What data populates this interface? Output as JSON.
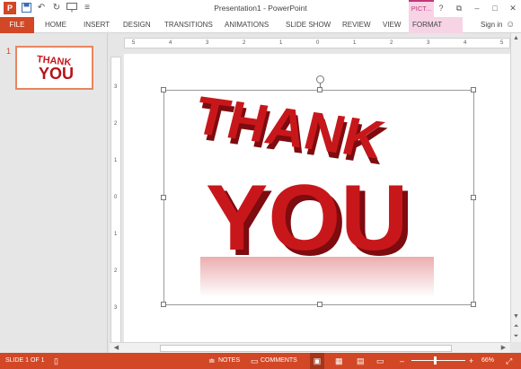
{
  "window": {
    "title": "Presentation1 - PowerPoint",
    "contextual_tab": "PICT...",
    "help": "?",
    "controls": [
      "⧉",
      "–",
      "□",
      "✕"
    ]
  },
  "qat": {
    "logo": "P"
  },
  "ribbon": {
    "file": "FILE",
    "tabs": [
      "HOME",
      "INSERT",
      "DESIGN",
      "TRANSITIONS",
      "ANIMATIONS",
      "SLIDE SHOW",
      "REVIEW",
      "VIEW",
      "FORMAT"
    ],
    "signin": "Sign in"
  },
  "thumbnails": [
    {
      "number": "1"
    }
  ],
  "slide": {
    "line1": "THANK",
    "line2": "YOU"
  },
  "rulers": {
    "horizontal": [
      "5",
      "4",
      "3",
      "2",
      "1",
      "0",
      "1",
      "2",
      "3",
      "4",
      "5"
    ],
    "vertical": [
      "3",
      "2",
      "1",
      "0",
      "1",
      "2",
      "3"
    ]
  },
  "status": {
    "slide_info": "SLIDE 1 OF 1",
    "notes": "NOTES",
    "comments": "COMMENTS",
    "zoom": "66%"
  },
  "colors": {
    "accent": "#d24726",
    "format_tab": "#f6d4e6",
    "text_red": "#c8171b"
  },
  "icons": [
    "save-icon",
    "undo-icon",
    "redo-icon",
    "present-icon",
    "smiley-icon",
    "notes-icon",
    "comments-icon",
    "normal-view-icon",
    "slide-sorter-icon",
    "reading-view-icon",
    "slideshow-icon",
    "fit-slide-icon"
  ]
}
